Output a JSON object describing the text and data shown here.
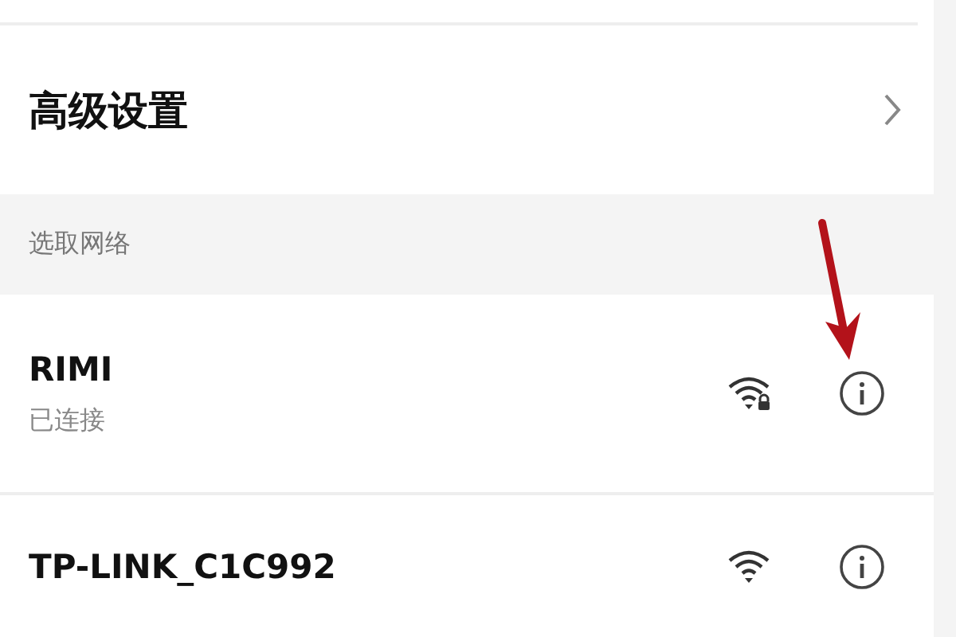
{
  "advanced_settings": {
    "label": "高级设置"
  },
  "section_header": "选取网络",
  "networks": [
    {
      "name": "RIMI",
      "status": "已连接",
      "secured": true
    },
    {
      "name": "TP-LINK_C1C992",
      "secured": false
    }
  ]
}
